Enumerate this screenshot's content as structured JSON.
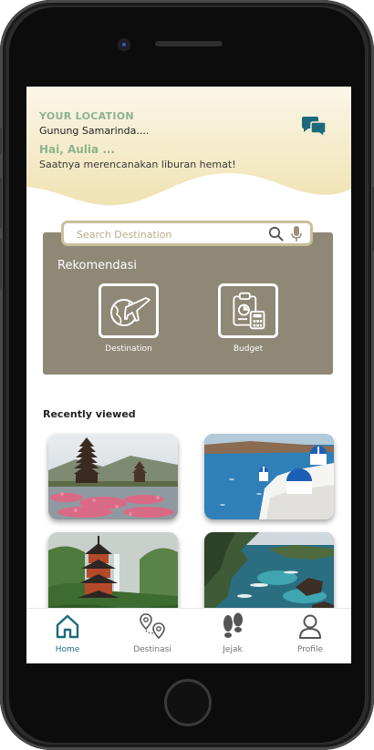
{
  "header": {
    "location_label": "YOUR LOCATION",
    "location_value": "Gunung Samarinda....",
    "greeting": "Hai, Aulia ...",
    "tagline": "Saatnya merencanakan liburan hemat!"
  },
  "search": {
    "placeholder": "Search Destination"
  },
  "recommendations": {
    "title": "Rekomendasi",
    "items": [
      {
        "label": "Destination",
        "icon": "globe-plane-icon"
      },
      {
        "label": "Budget",
        "icon": "budget-clipboard-icon"
      }
    ]
  },
  "recent": {
    "title": "Recently viewed",
    "items": [
      {
        "image": "bali-temple-lake"
      },
      {
        "image": "santorini-blue-domes"
      },
      {
        "image": "japanese-pagoda-waterfall"
      },
      {
        "image": "coastal-cliff-cove"
      }
    ]
  },
  "bottom_nav": {
    "items": [
      {
        "label": "Home",
        "icon": "home-icon",
        "active": true
      },
      {
        "label": "Destinasi",
        "icon": "map-pins-icon",
        "active": false
      },
      {
        "label": "Jejak",
        "icon": "footprints-icon",
        "active": false
      },
      {
        "label": "Profile",
        "icon": "user-icon",
        "active": false
      }
    ]
  },
  "colors": {
    "header_gradient_top": "#f8f2dc",
    "header_gradient_bottom": "#efe2b2",
    "accent_green": "#8db38c",
    "card_brown": "#8f8876",
    "search_border": "#c9bf9c",
    "nav_active": "#1b6a7c",
    "chat_icon": "#1b6a7c"
  }
}
